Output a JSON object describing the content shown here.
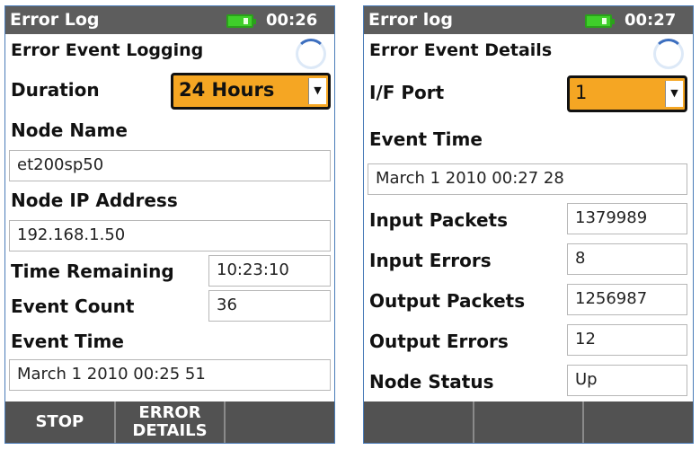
{
  "left_screen": {
    "title": "Error Log",
    "clock": "00:26",
    "heading": "Error Event Logging",
    "duration": {
      "label": "Duration",
      "value": "24 Hours"
    },
    "node_name": {
      "label": "Node Name",
      "value": "et200sp50"
    },
    "node_ip": {
      "label": "Node IP Address",
      "value": "192.168.1.50"
    },
    "time_remaining": {
      "label": "Time Remaining",
      "value": "10:23:10"
    },
    "event_count": {
      "label": "Event Count",
      "value": "36"
    },
    "event_time": {
      "label": "Event Time",
      "value": "March 1 2010 00:25 51"
    },
    "softkeys": {
      "stop": "STOP",
      "error_details_line1": "ERROR",
      "error_details_line2": "DETAILS",
      "blank": ""
    }
  },
  "right_screen": {
    "title": "Error log",
    "clock": "00:27",
    "heading": "Error Event Details",
    "if_port": {
      "label": "I/F Port",
      "value": "1"
    },
    "event_time": {
      "label": "Event Time",
      "value": "March 1 2010 00:27 28"
    },
    "input_packets": {
      "label": "Input Packets",
      "value": "1379989"
    },
    "input_errors": {
      "label": "Input Errors",
      "value": "8"
    },
    "output_packets": {
      "label": "Output Packets",
      "value": "1256987"
    },
    "output_errors": {
      "label": "Output Errors",
      "value": "12"
    },
    "node_status": {
      "label": "Node Status",
      "value": "Up"
    },
    "softkeys": {
      "key1": "",
      "key2": "",
      "key3": ""
    }
  },
  "colors": {
    "titlebar": "#5d5d5d",
    "dropdown_accent": "#f5a623",
    "battery": "#3fcf2a",
    "frame": "#4a7cb8",
    "softkey_bar": "#4a4a4a"
  },
  "icons": [
    "battery-icon",
    "busy-spinner-icon",
    "dropdown-arrow-icon"
  ]
}
